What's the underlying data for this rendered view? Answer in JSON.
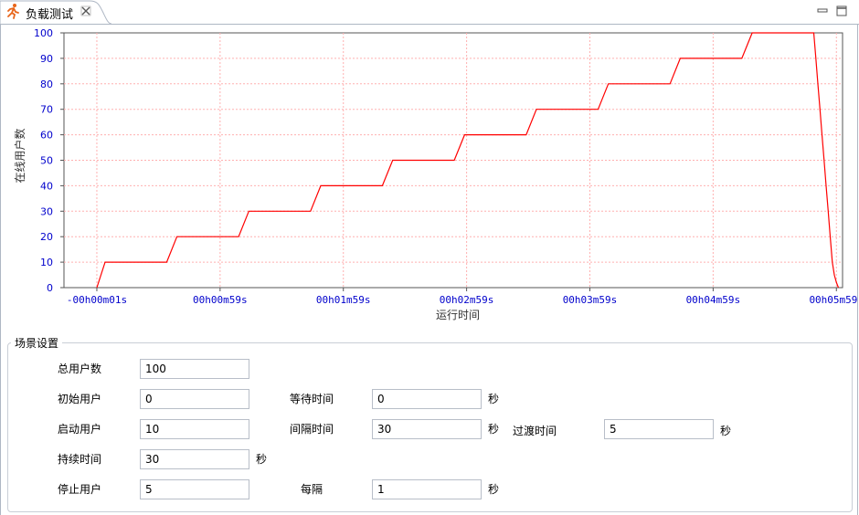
{
  "tab": {
    "title": "负载测试",
    "icon": "running-man-icon"
  },
  "chart_data": {
    "type": "line",
    "title": "",
    "xlabel": "运行时间",
    "ylabel": "在线用户数",
    "ylim": [
      0,
      100
    ],
    "yticks": [
      0,
      10,
      20,
      30,
      40,
      50,
      60,
      70,
      80,
      90,
      100
    ],
    "xticks": [
      "-00h00m01s",
      "00h00m59s",
      "00h01m59s",
      "00h02m59s",
      "00h03m59s",
      "00h04m59s",
      "00h05m59s"
    ],
    "xtick_seconds": [
      -1,
      59,
      119,
      179,
      239,
      299,
      359
    ],
    "xlim_seconds": [
      -17,
      362
    ],
    "grid": true,
    "line_color": "#ff0000",
    "axis_label_color": "#0000cc",
    "series": [
      {
        "x": [
          -1,
          3,
          33,
          38,
          68,
          73,
          103,
          108,
          138,
          143,
          173,
          178,
          208,
          213,
          243,
          248,
          278,
          283,
          313,
          318,
          348,
          349,
          350,
          351,
          352,
          353,
          354,
          355,
          356,
          357,
          358,
          359,
          360
        ],
        "y": [
          0,
          10,
          10,
          20,
          20,
          30,
          30,
          40,
          40,
          50,
          50,
          60,
          60,
          70,
          70,
          80,
          80,
          90,
          90,
          100,
          100,
          90,
          80,
          70,
          60,
          50,
          40,
          30,
          20,
          10,
          5,
          2,
          0
        ]
      }
    ]
  },
  "scenario": {
    "title": "场景设置",
    "total_users": {
      "label": "总用户数",
      "value": "100"
    },
    "initial_users": {
      "label": "初始用户",
      "value": "0"
    },
    "wait_time": {
      "label": "等待时间",
      "value": "0",
      "unit": "秒"
    },
    "start_users": {
      "label": "启动用户",
      "value": "10"
    },
    "interval_time": {
      "label": "间隔时间",
      "value": "30",
      "unit": "秒"
    },
    "transition_time": {
      "label": "过渡时间",
      "value": "5",
      "unit": "秒"
    },
    "duration": {
      "label": "持续时间",
      "value": "30",
      "unit": "秒"
    },
    "stop_users": {
      "label": "停止用户",
      "value": "5"
    },
    "every": {
      "label": "每隔",
      "value": "1",
      "unit": "秒"
    }
  }
}
